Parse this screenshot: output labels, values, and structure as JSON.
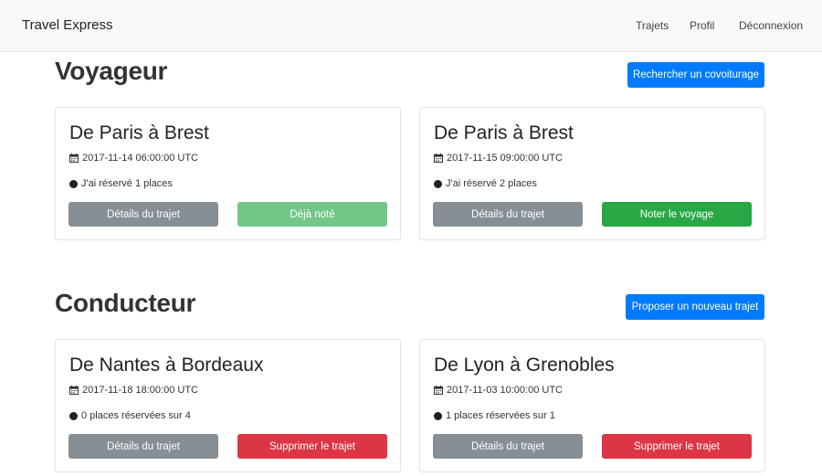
{
  "navbar": {
    "brand": "Travel Express",
    "links": [
      "Trajets",
      "Profil",
      "Déconnexion"
    ]
  },
  "voyageur": {
    "title": "Voyageur",
    "action": "Rechercher un covoiturage",
    "cards": [
      {
        "title": "De Paris à Brest",
        "date": "2017-11-14 06:00:00 UTC",
        "status": "J'ai réservé 1 places",
        "details": "Détails du trajet",
        "action": "Déjà noté"
      },
      {
        "title": "De Paris à Brest",
        "date": "2017-11-15 09:00:00 UTC",
        "status": "J'ai réservé 2 places",
        "details": "Détails du trajet",
        "action": "Noter le voyage"
      }
    ]
  },
  "conducteur": {
    "title": "Conducteur",
    "action": "Proposer un nouveau trajet",
    "cards": [
      {
        "title": "De Nantes à Bordeaux",
        "date": "2017-11-18 18:00:00 UTC",
        "status": "0 places réservées sur 4",
        "details": "Détails du trajet",
        "action": "Supprimer le trajet"
      },
      {
        "title": "De Lyon à Grenobles",
        "date": "2017-11-03 10:00:00 UTC",
        "status": "1 places réservées sur 1",
        "details": "Détails du trajet",
        "action": "Supprimer le trajet"
      }
    ]
  },
  "colors": {
    "primary": "#007bff",
    "secondary": "#868e96",
    "success": "#28a745",
    "success_disabled": "#74c686",
    "danger": "#dc3545"
  }
}
